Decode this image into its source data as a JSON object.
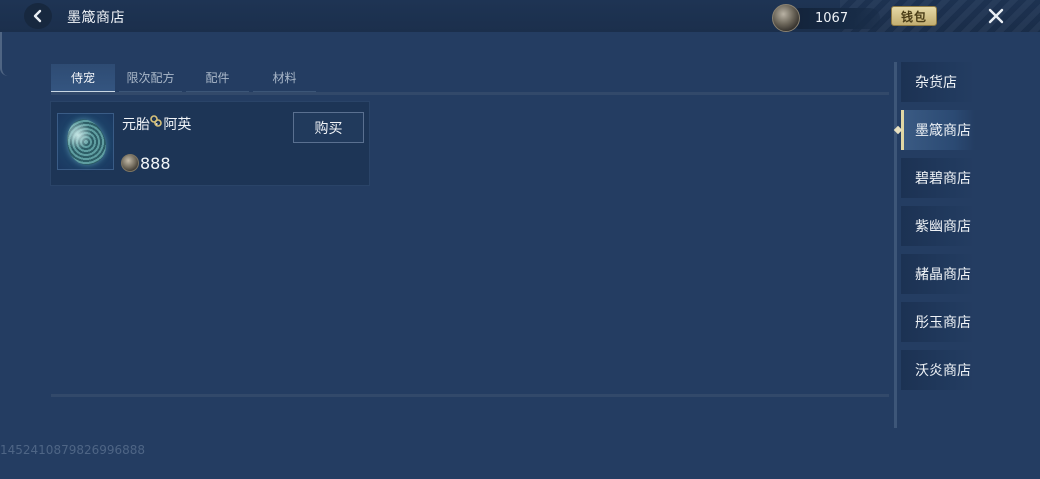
{
  "header": {
    "title": "墨箴商店",
    "currency_value": "1067",
    "wallet_label": "钱包"
  },
  "tabs": [
    {
      "label": "侍宠",
      "active": true
    },
    {
      "label": "限次配方",
      "active": false
    },
    {
      "label": "配件",
      "active": false
    },
    {
      "label": "材料",
      "active": false
    }
  ],
  "items": [
    {
      "name": "元胎 · 阿英",
      "price": "888",
      "buy_label": "购买"
    }
  ],
  "side_nav": [
    {
      "label": "杂货店",
      "active": false
    },
    {
      "label": "墨箴商店",
      "active": true
    },
    {
      "label": "碧碧商店",
      "active": false
    },
    {
      "label": "紫幽商店",
      "active": false
    },
    {
      "label": "赭晶商店",
      "active": false
    },
    {
      "label": "彤玉商店",
      "active": false
    },
    {
      "label": "沃炎商店",
      "active": false
    }
  ],
  "footer": {
    "id_text": "1452410879826996888"
  },
  "colors": {
    "background": "#243d62",
    "accent_gold": "#e1d7a4"
  }
}
